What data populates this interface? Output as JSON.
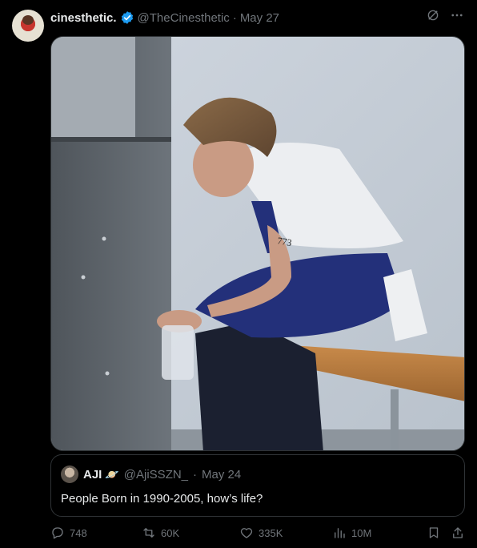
{
  "tweet": {
    "display_name": "cinesthetic.",
    "handle": "@TheCinesthetic",
    "separator": "·",
    "date": "May 27",
    "colors": {
      "accent": "#1d9bf0",
      "muted": "#71767b",
      "text": "#e7e9ea",
      "background": "#000000"
    },
    "header_icons": [
      "grok-icon",
      "more-icon"
    ]
  },
  "media": {
    "tattoo_text": "773"
  },
  "quote": {
    "display_name": "AJI",
    "emoji": "🪐",
    "handle": "@AjiSSZN_",
    "separator": "·",
    "date": "May 24",
    "text": "People Born in 1990-2005, how’s life?"
  },
  "actions": {
    "replies": "748",
    "reposts": "60K",
    "likes": "335K",
    "views": "10M"
  }
}
